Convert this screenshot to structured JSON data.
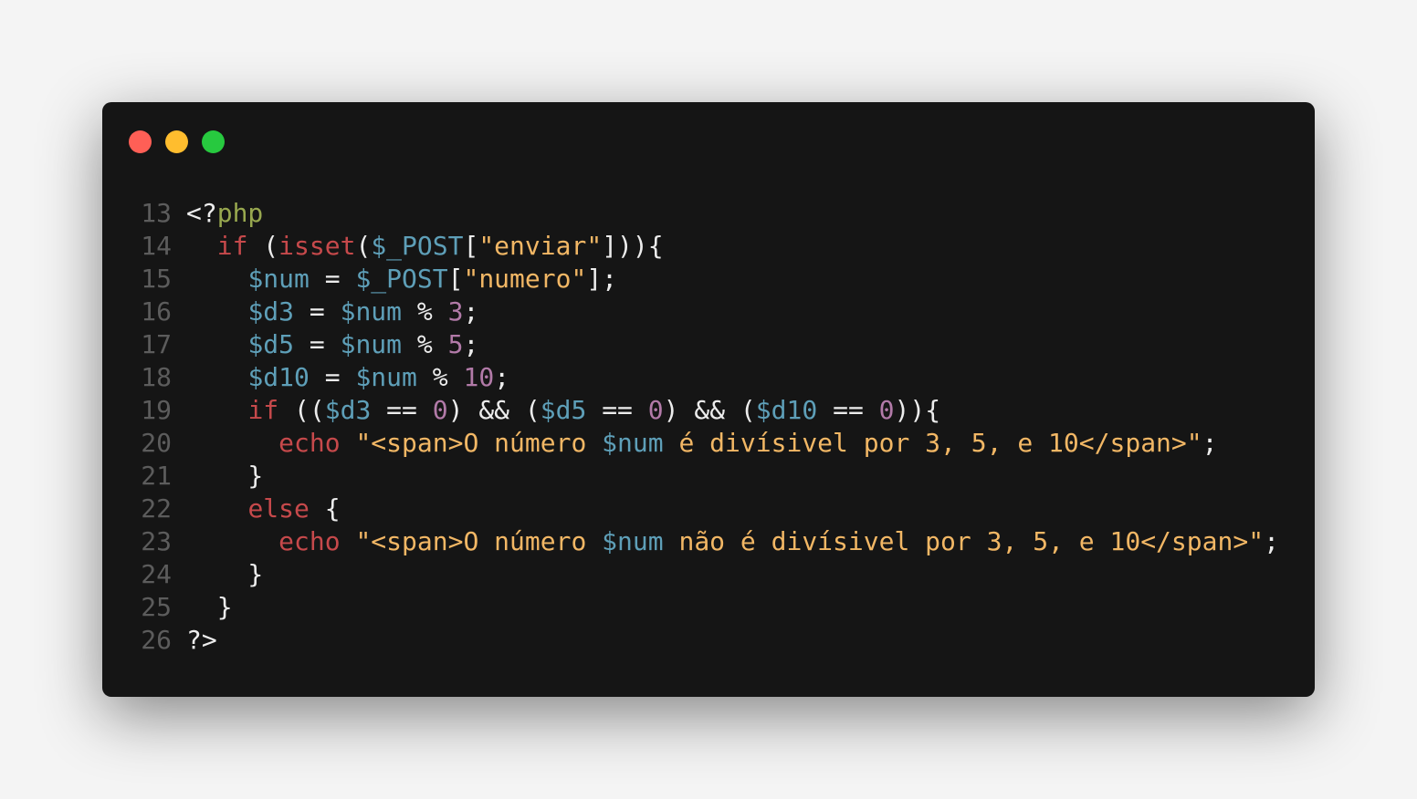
{
  "window": {
    "controls": [
      "close",
      "minimize",
      "maximize"
    ]
  },
  "colors": {
    "keyword": "#c6494b",
    "variable": "#5e9fb8",
    "string": "#f2b765",
    "number": "#b27aa8",
    "php_tag": "#98a84f",
    "plain": "#ececec",
    "line_number": "#5c5c5c",
    "background": "#151515"
  },
  "lines": [
    {
      "n": "13",
      "tokens": [
        {
          "t": "<?",
          "c": "w"
        },
        {
          "t": "php",
          "c": "p"
        }
      ]
    },
    {
      "n": "14",
      "tokens": [
        {
          "t": "  ",
          "c": "w"
        },
        {
          "t": "if",
          "c": "k"
        },
        {
          "t": " (",
          "c": "w"
        },
        {
          "t": "isset",
          "c": "k"
        },
        {
          "t": "(",
          "c": "w"
        },
        {
          "t": "$_POST",
          "c": "v"
        },
        {
          "t": "[",
          "c": "w"
        },
        {
          "t": "\"enviar\"",
          "c": "s"
        },
        {
          "t": "])){",
          "c": "w"
        }
      ]
    },
    {
      "n": "15",
      "tokens": [
        {
          "t": "    ",
          "c": "w"
        },
        {
          "t": "$num",
          "c": "v"
        },
        {
          "t": " = ",
          "c": "w"
        },
        {
          "t": "$_POST",
          "c": "v"
        },
        {
          "t": "[",
          "c": "w"
        },
        {
          "t": "\"numero\"",
          "c": "s"
        },
        {
          "t": "];",
          "c": "w"
        }
      ]
    },
    {
      "n": "16",
      "tokens": [
        {
          "t": "    ",
          "c": "w"
        },
        {
          "t": "$d3",
          "c": "v"
        },
        {
          "t": " = ",
          "c": "w"
        },
        {
          "t": "$num",
          "c": "v"
        },
        {
          "t": " % ",
          "c": "w"
        },
        {
          "t": "3",
          "c": "n"
        },
        {
          "t": ";",
          "c": "w"
        }
      ]
    },
    {
      "n": "17",
      "tokens": [
        {
          "t": "    ",
          "c": "w"
        },
        {
          "t": "$d5",
          "c": "v"
        },
        {
          "t": " = ",
          "c": "w"
        },
        {
          "t": "$num",
          "c": "v"
        },
        {
          "t": " % ",
          "c": "w"
        },
        {
          "t": "5",
          "c": "n"
        },
        {
          "t": ";",
          "c": "w"
        }
      ]
    },
    {
      "n": "18",
      "tokens": [
        {
          "t": "    ",
          "c": "w"
        },
        {
          "t": "$d10",
          "c": "v"
        },
        {
          "t": " = ",
          "c": "w"
        },
        {
          "t": "$num",
          "c": "v"
        },
        {
          "t": " % ",
          "c": "w"
        },
        {
          "t": "10",
          "c": "n"
        },
        {
          "t": ";",
          "c": "w"
        }
      ]
    },
    {
      "n": "19",
      "tokens": [
        {
          "t": "    ",
          "c": "w"
        },
        {
          "t": "if",
          "c": "k"
        },
        {
          "t": " ((",
          "c": "w"
        },
        {
          "t": "$d3",
          "c": "v"
        },
        {
          "t": " == ",
          "c": "w"
        },
        {
          "t": "0",
          "c": "n"
        },
        {
          "t": ") && (",
          "c": "w"
        },
        {
          "t": "$d5",
          "c": "v"
        },
        {
          "t": " == ",
          "c": "w"
        },
        {
          "t": "0",
          "c": "n"
        },
        {
          "t": ") && (",
          "c": "w"
        },
        {
          "t": "$d10",
          "c": "v"
        },
        {
          "t": " == ",
          "c": "w"
        },
        {
          "t": "0",
          "c": "n"
        },
        {
          "t": ")){",
          "c": "w"
        }
      ]
    },
    {
      "n": "20",
      "tokens": [
        {
          "t": "      ",
          "c": "w"
        },
        {
          "t": "echo",
          "c": "k"
        },
        {
          "t": " ",
          "c": "w"
        },
        {
          "t": "\"<span>O número ",
          "c": "s"
        },
        {
          "t": "$num",
          "c": "v"
        },
        {
          "t": " é divísivel por 3, 5, e 10</span>\"",
          "c": "s"
        },
        {
          "t": ";",
          "c": "w"
        }
      ]
    },
    {
      "n": "21",
      "tokens": [
        {
          "t": "    }",
          "c": "w"
        }
      ]
    },
    {
      "n": "22",
      "tokens": [
        {
          "t": "    ",
          "c": "w"
        },
        {
          "t": "else",
          "c": "k"
        },
        {
          "t": " {",
          "c": "w"
        }
      ]
    },
    {
      "n": "23",
      "tokens": [
        {
          "t": "      ",
          "c": "w"
        },
        {
          "t": "echo",
          "c": "k"
        },
        {
          "t": " ",
          "c": "w"
        },
        {
          "t": "\"<span>O número ",
          "c": "s"
        },
        {
          "t": "$num",
          "c": "v"
        },
        {
          "t": " não é divísivel por 3, 5, e 10</span>\"",
          "c": "s"
        },
        {
          "t": ";",
          "c": "w"
        }
      ]
    },
    {
      "n": "24",
      "tokens": [
        {
          "t": "    }",
          "c": "w"
        }
      ]
    },
    {
      "n": "25",
      "tokens": [
        {
          "t": "  }",
          "c": "w"
        }
      ]
    },
    {
      "n": "26",
      "tokens": [
        {
          "t": "?>",
          "c": "w"
        }
      ]
    }
  ]
}
